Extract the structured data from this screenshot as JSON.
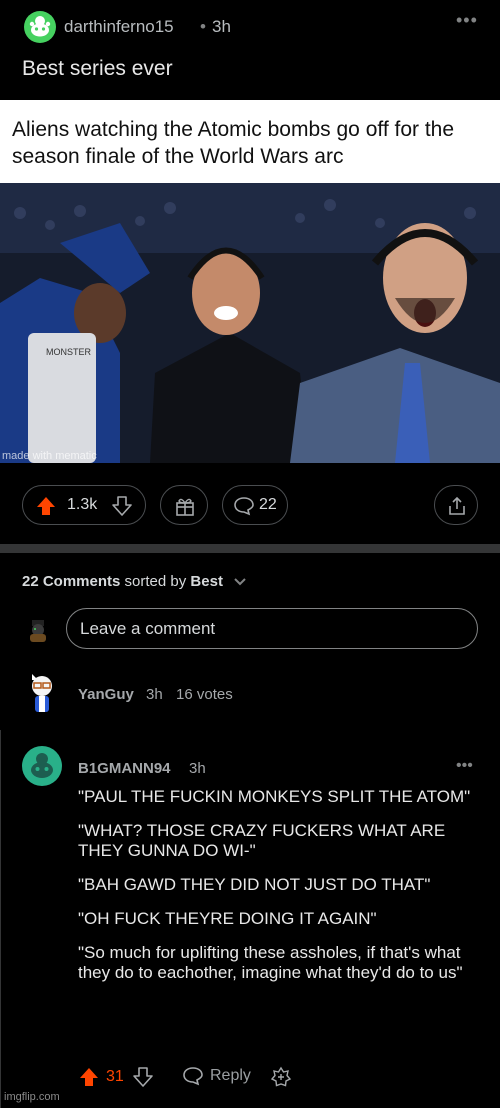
{
  "post": {
    "username": "darthinferno15",
    "separator": "•",
    "time": "3h",
    "more": "•••",
    "title": "Best series ever"
  },
  "meme": {
    "caption": "Aliens watching the Atomic bombs go off for the season finale of the World Wars arc",
    "watermark": "made with mematic",
    "can_text": "MONSTER"
  },
  "actions": {
    "score": "1.3k",
    "comment_count": "22"
  },
  "comments_header": {
    "count_label": "22 Comments",
    "sort_label": "sorted by",
    "sort_value": "Best"
  },
  "input": {
    "placeholder": "Leave a comment"
  },
  "comments": [
    {
      "username": "YanGuy",
      "time": "3h",
      "votes": "16 votes"
    },
    {
      "username": "B1GMANN94",
      "time": "3h",
      "more": "•••",
      "paragraphs": [
        "\"PAUL THE FUCKIN MONKEYS SPLIT THE ATOM\"",
        "\"WHAT? THOSE CRAZY FUCKERS WHAT ARE THEY GUNNA DO WI-\"",
        "\"BAH GAWD THEY DID NOT JUST DO THAT\"",
        "\"OH FUCK THEYRE DOING IT AGAIN\"",
        "\"So much for uplifting these assholes, if that's what they do to eachother, imagine what they'd do to us\""
      ],
      "score": "31",
      "reply_label": "Reply"
    }
  ],
  "footer": {
    "watermark": "imgflip.com"
  },
  "colors": {
    "upvote": "#ff4500",
    "background": "#000000",
    "border": "#4a4d50",
    "avatar_post": "#46d160",
    "avatar_comment": "#29b089"
  },
  "icons": [
    "reddit-snoo-icon",
    "upvote-icon",
    "downvote-icon",
    "gift-icon",
    "comment-bubble-icon",
    "share-icon",
    "chevron-down-icon",
    "reply-icon",
    "award-icon"
  ]
}
